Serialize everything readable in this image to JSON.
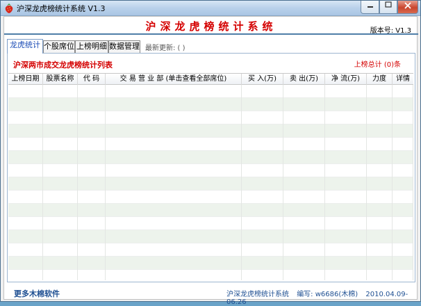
{
  "window": {
    "title": "沪深龙虎榜统计系统 V1.3"
  },
  "header": {
    "title": "沪深龙虎榜统计系统",
    "version": "版本号: V1.3"
  },
  "tabs": [
    {
      "label": "龙虎统计"
    },
    {
      "label": "个股席位"
    },
    {
      "label": "上榜明细"
    },
    {
      "label": "数据管理"
    }
  ],
  "latest_update": "最新更新: ( )",
  "panel": {
    "list_title": "沪深两市成交龙虎榜统计列表",
    "count": "上榜总计 (0)条"
  },
  "columns": [
    {
      "label": "上榜日期"
    },
    {
      "label": "股票名称"
    },
    {
      "label": "代 码"
    },
    {
      "label": "交 易 营 业 部 (单击查看全部席位)"
    },
    {
      "label": "买 入(万)"
    },
    {
      "label": "卖 出(万)"
    },
    {
      "label": "净 流(万)"
    },
    {
      "label": "力度"
    },
    {
      "label": "详情"
    }
  ],
  "footer": {
    "more": "更多木棉软件",
    "app_name": "沪深龙虎榜统计系统",
    "author": "编写: w6686(木棉)",
    "date_range": "2010.04.09-06.26"
  },
  "colors": {
    "accent_red": "#d40000",
    "link_blue": "#1e4f92",
    "row_alt": "#edf3ec"
  },
  "icons": {
    "app": "strawberry-icon"
  }
}
